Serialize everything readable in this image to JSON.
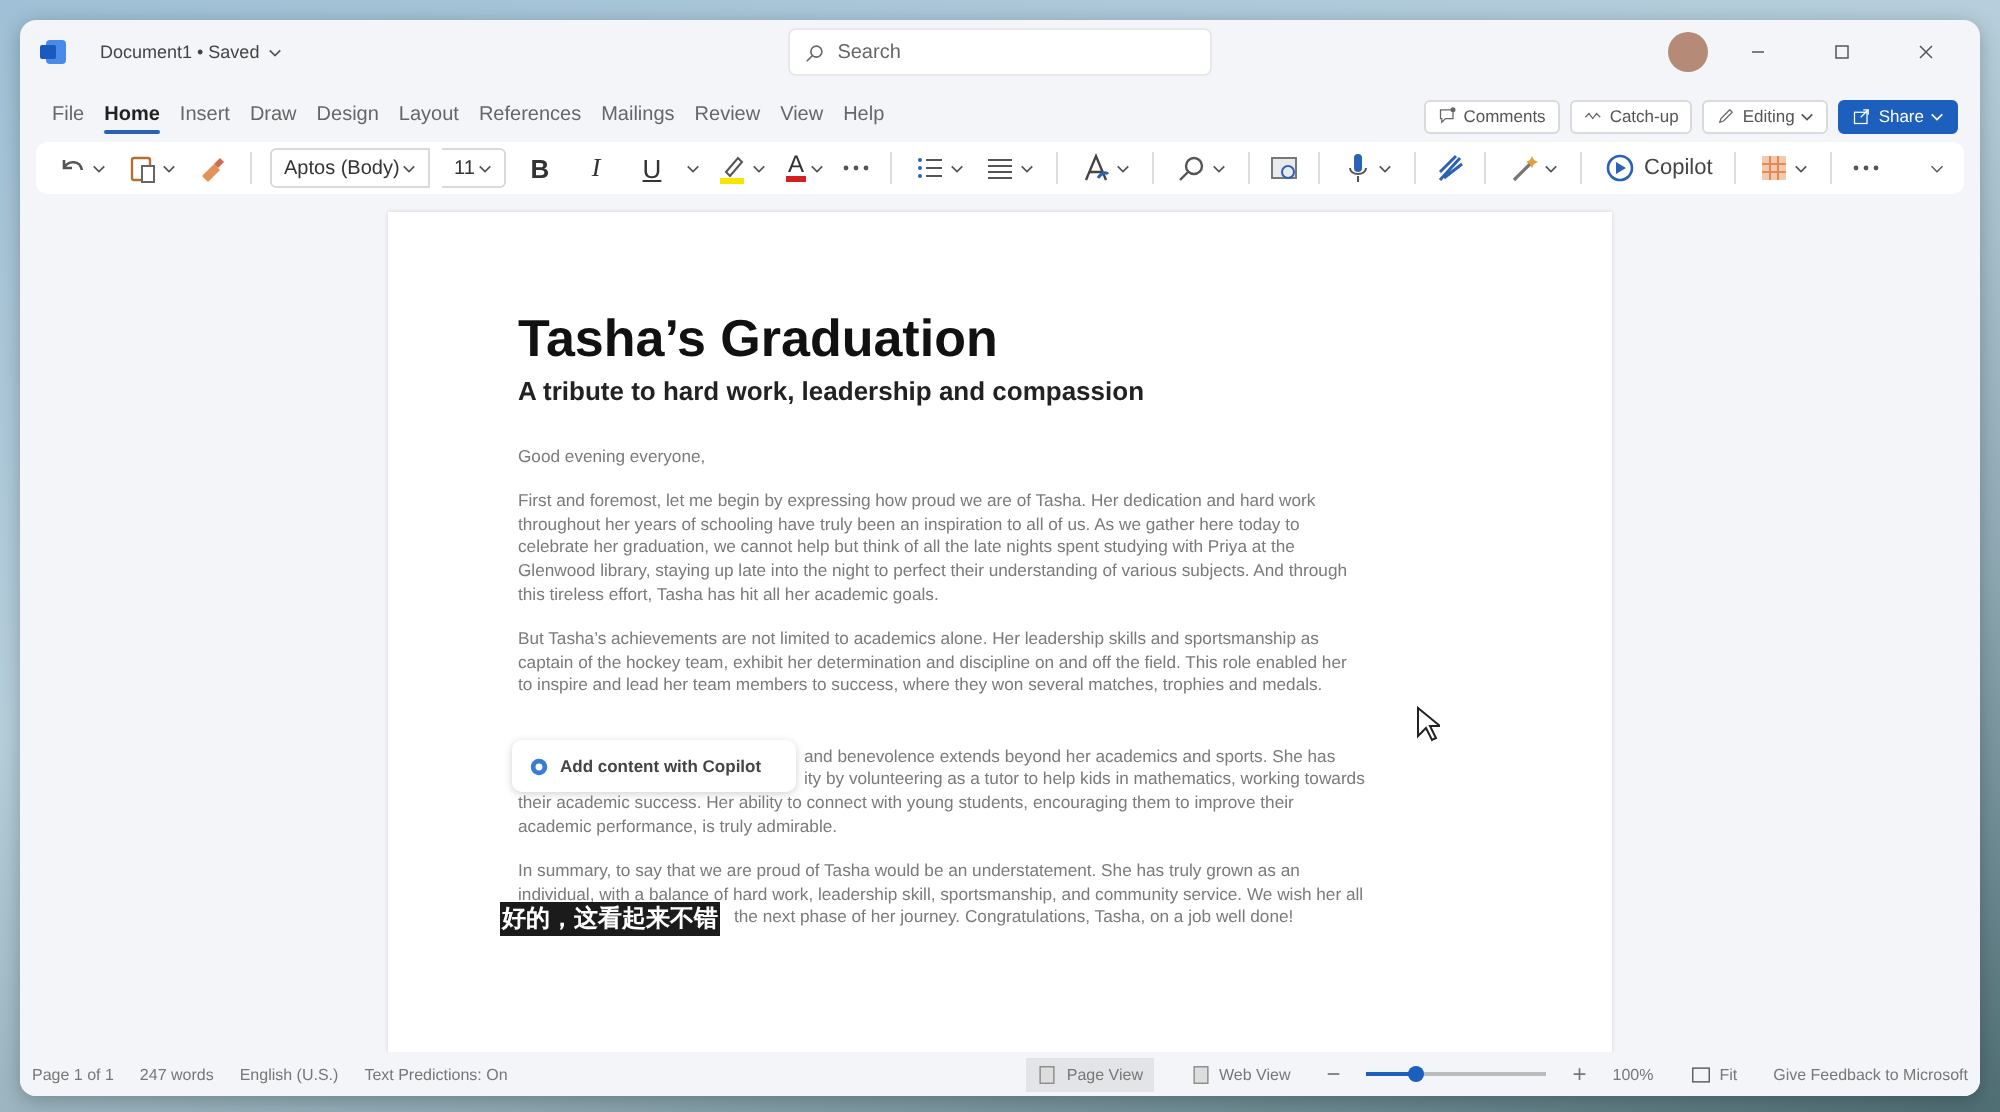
{
  "window": {
    "title": "Document1 • Saved",
    "search": {
      "placeholder": "Search"
    }
  },
  "tabs": [
    {
      "label": "File",
      "selected": false
    },
    {
      "label": "Home",
      "selected": true
    },
    {
      "label": "Insert",
      "selected": false
    },
    {
      "label": "Draw",
      "selected": false
    },
    {
      "label": "Design",
      "selected": false
    },
    {
      "label": "Layout",
      "selected": false
    },
    {
      "label": "References",
      "selected": false
    },
    {
      "label": "Mailings",
      "selected": false
    },
    {
      "label": "Review",
      "selected": false
    },
    {
      "label": "View",
      "selected": false
    },
    {
      "label": "Help",
      "selected": false
    }
  ],
  "actions": [
    {
      "label": "Comments",
      "kind": "comments"
    },
    {
      "label": "Catch-up",
      "kind": "catchup"
    },
    {
      "label": "Editing",
      "kind": "editing"
    },
    {
      "label": "Share",
      "kind": "share"
    }
  ],
  "ribbon": {
    "font_family": "Aptos (Body)",
    "font_size": "11",
    "format_buttons": [
      {
        "label": "B",
        "kind": "bold"
      },
      {
        "label": "I",
        "kind": "italic"
      },
      {
        "label": "U",
        "kind": "underline"
      }
    ],
    "font_color": "A",
    "copilot": "Copilot"
  },
  "document": {
    "title": "Tasha’s Graduation",
    "subtitle": "A tribute to hard work, leadership and compassion",
    "paragraphs": [
      {
        "lines": [
          "Good evening everyone,"
        ]
      },
      {
        "lines": [
          "First and foremost, let me begin by expressing how proud we are of Tasha. Her dedication and hard work",
          "throughout her years of schooling have truly been an inspiration to all of us. As we gather here today to",
          "celebrate her graduation, we cannot help but think of all the late nights spent studying with Priya at the",
          "Glenwood library, staying up late into the night to perfect their understanding of various subjects. And through",
          "this tireless effort, Tasha has hit all her academic goals."
        ]
      },
      {
        "lines": [
          "But Tasha’s achievements are not limited to academics alone. Her leadership skills and sportsmanship as",
          "captain of the hockey team, exhibit her determination and discipline on and off the field. This role enabled her",
          "to inspire and lead her team members to success, where they won several matches, trophies and medals."
        ]
      },
      {
        "lines_beside_prompt": [
          "and benevolence extends beyond her academics and sports. She has",
          "ity by volunteering as a tutor to help kids in mathematics, working towards"
        ],
        "lines": [
          "their academic success. Her ability to connect with young students, encouraging them to improve their",
          "academic performance, is truly admirable."
        ]
      },
      {
        "lines": [
          "In summary, to say that we are proud of Tasha would be an understatement. She has truly grown as an",
          "individual, with a balance of hard work, leadership skill, sportsmanship, and community service. We wish her all"
        ],
        "lines_beside_caption": [
          "the next phase of her journey. Congratulations, Tasha, on a job well done!"
        ]
      }
    ],
    "copilot_prompt": "Add content with Copilot"
  },
  "subtitle_caption": "好的，这看起来不错",
  "status_bar": {
    "items": [
      "Page 1 of 1",
      "247 words",
      "English (U.S.)",
      "Text Predictions: On"
    ],
    "views": [
      {
        "label": "Page View",
        "selected": true
      },
      {
        "label": "Web View",
        "selected": false
      }
    ],
    "zoom": {
      "out_label": "−",
      "level": 0.28,
      "in_label": "+",
      "reading": "100%"
    },
    "fit": "Fit",
    "feedback": "Give Feedback to Microsoft"
  }
}
